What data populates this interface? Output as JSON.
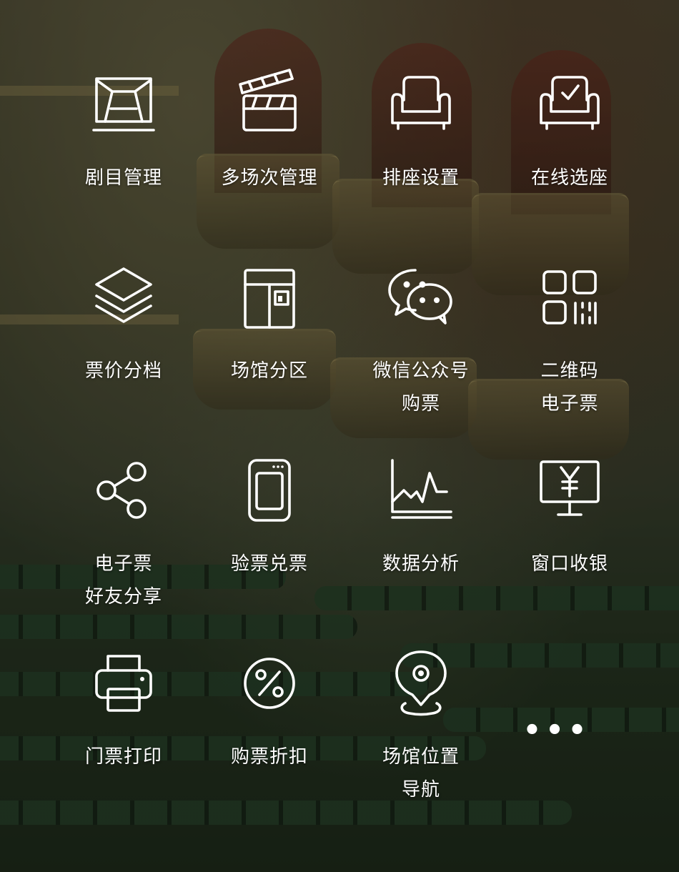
{
  "features": [
    {
      "icon": "stage-icon",
      "lines": [
        "剧目管理"
      ]
    },
    {
      "icon": "clapperboard-icon",
      "lines": [
        "多场次管理"
      ]
    },
    {
      "icon": "seat-icon",
      "lines": [
        "排座设置"
      ]
    },
    {
      "icon": "seat-check-icon",
      "lines": [
        "在线选座"
      ]
    },
    {
      "icon": "layers-icon",
      "lines": [
        "票价分档"
      ]
    },
    {
      "icon": "layout-icon",
      "lines": [
        "场馆分区"
      ]
    },
    {
      "icon": "wechat-icon",
      "lines": [
        "微信公众号",
        "购票"
      ]
    },
    {
      "icon": "qr-code-icon",
      "lines": [
        "二维码",
        "电子票"
      ]
    },
    {
      "icon": "share-icon",
      "lines": [
        "电子票",
        "好友分享"
      ]
    },
    {
      "icon": "scanner-device-icon",
      "lines": [
        "验票兑票"
      ]
    },
    {
      "icon": "chart-icon",
      "lines": [
        "数据分析"
      ]
    },
    {
      "icon": "cashier-monitor-icon",
      "lines": [
        "窗口收银"
      ]
    },
    {
      "icon": "printer-icon",
      "lines": [
        "门票打印"
      ]
    },
    {
      "icon": "discount-icon",
      "lines": [
        "购票折扣"
      ]
    },
    {
      "icon": "location-pin-icon",
      "lines": [
        "场馆位置",
        "导航"
      ]
    },
    {
      "icon": "more-icon",
      "symbol": "•••"
    }
  ],
  "colors": {
    "text": "#ffffff",
    "icon": "#ffffff"
  }
}
